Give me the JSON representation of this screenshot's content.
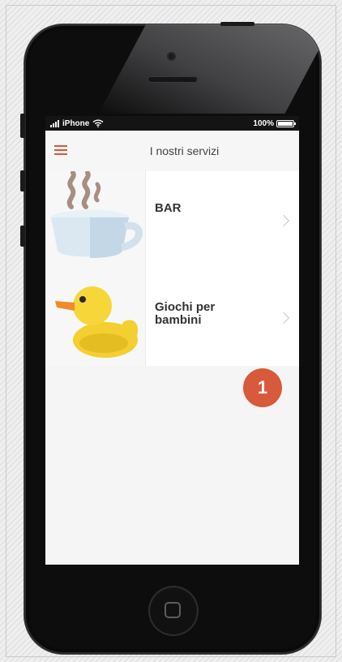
{
  "status_bar": {
    "carrier": "iPhone",
    "battery": "100%"
  },
  "header": {
    "title": "I nostri servizi",
    "menu_icon": "hamburger-icon"
  },
  "services": [
    {
      "label": "BAR",
      "icon": "coffee-cup-icon"
    },
    {
      "label": "Giochi per bambini",
      "icon": "rubber-duck-icon"
    }
  ],
  "annotation": {
    "badge": "1",
    "color": "#d85a3c"
  },
  "colors": {
    "accent": "#e0523a",
    "phone_body": "#0d0d0e"
  }
}
